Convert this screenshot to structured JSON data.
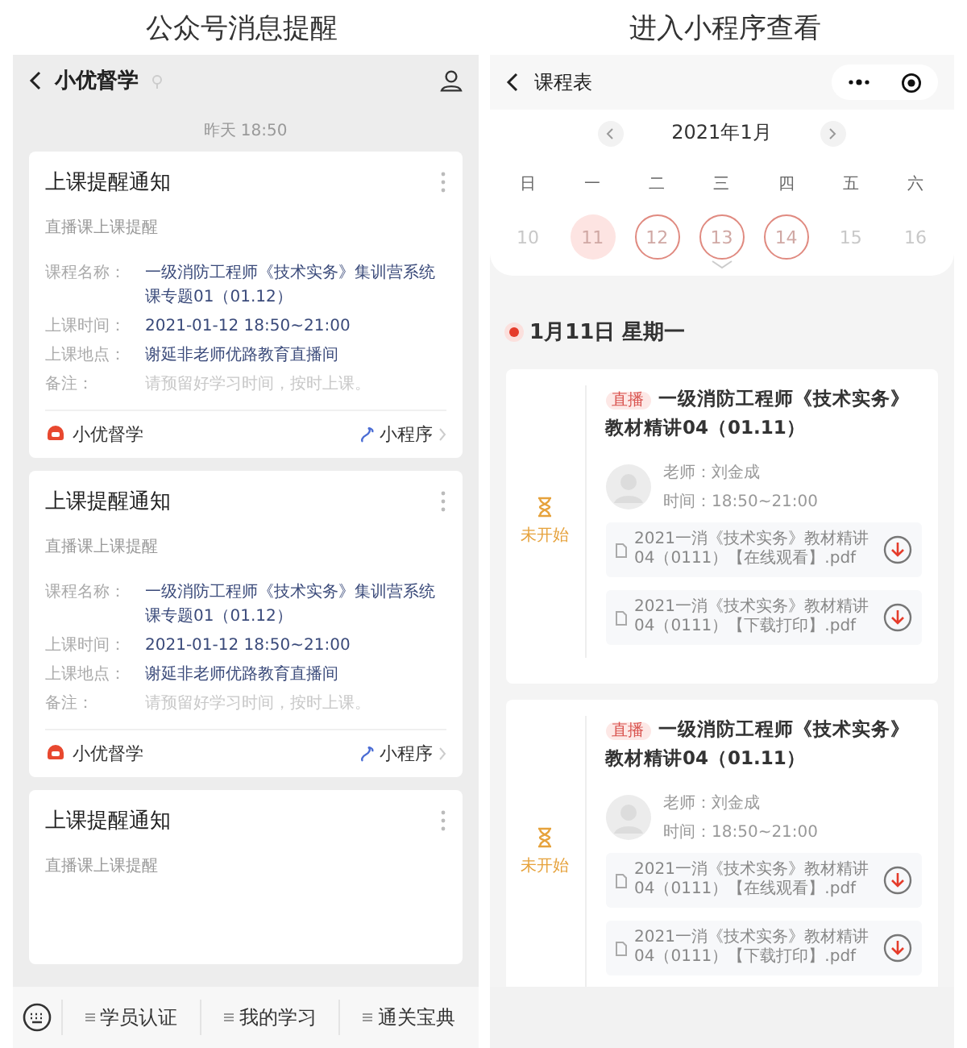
{
  "captions": [
    "公众号消息提醒",
    "进入小程序查看"
  ],
  "left": {
    "header": {
      "title": "小优督学"
    },
    "timestamp": "昨天 18:50",
    "messages": [
      {
        "title": "上课提醒通知",
        "subtitle": "直播课上课提醒",
        "fields": [
          {
            "label": "课程名称：",
            "value": "一级消防工程师《技术实务》集训营系统课专题01（01.12）",
            "kind": "info"
          },
          {
            "label": "上课时间：",
            "value": "2021-01-12 18:50~21:00",
            "kind": "info"
          },
          {
            "label": "上课地点：",
            "value": "谢延非老师优路教育直播间",
            "kind": "info"
          },
          {
            "label": "备注：",
            "value": "请预留好学习时间，按时上课。",
            "kind": "note"
          }
        ],
        "footer": {
          "brand": "小优督学",
          "link": "小程序"
        }
      },
      {
        "title": "上课提醒通知",
        "subtitle": "直播课上课提醒",
        "fields": [
          {
            "label": "课程名称：",
            "value": "一级消防工程师《技术实务》集训营系统课专题01（01.12）",
            "kind": "info"
          },
          {
            "label": "上课时间：",
            "value": "2021-01-12 18:50~21:00",
            "kind": "info"
          },
          {
            "label": "上课地点：",
            "value": "谢延非老师优路教育直播间",
            "kind": "info"
          },
          {
            "label": "备注：",
            "value": "请预留好学习时间，按时上课。",
            "kind": "note"
          }
        ],
        "footer": {
          "brand": "小优督学",
          "link": "小程序"
        }
      },
      {
        "title": "上课提醒通知",
        "subtitle": "直播课上课提醒"
      }
    ],
    "menu": [
      "学员认证",
      "我的学习",
      "通关宝典"
    ]
  },
  "right": {
    "header": {
      "title": "课程表"
    },
    "month": "2021年1月",
    "weekdays": [
      "日",
      "一",
      "二",
      "三",
      "四",
      "五",
      "六"
    ],
    "days": [
      {
        "label": "10",
        "selected": false,
        "has_course": false
      },
      {
        "label": "11",
        "selected": true,
        "has_course": false
      },
      {
        "label": "12",
        "selected": false,
        "has_course": true
      },
      {
        "label": "13",
        "selected": false,
        "has_course": true
      },
      {
        "label": "14",
        "selected": false,
        "has_course": true
      },
      {
        "label": "15",
        "selected": false,
        "has_course": false
      },
      {
        "label": "16",
        "selected": false,
        "has_course": false
      }
    ],
    "date_heading": "1月11日 星期一",
    "courses": [
      {
        "status": "未开始",
        "tag": "直播",
        "title": "一级消防工程师《技术实务》教材精讲04（01.11）",
        "teacher": "老师：刘金成",
        "time": "时间：18:50~21:00",
        "files": [
          {
            "lines": [
              "2021一消《技术实务》教材精讲",
              "04（0111）【在线观看】.pdf"
            ]
          },
          {
            "lines": [
              "2021一消《技术实务》教材精讲",
              "04（0111）【下载打印】.pdf"
            ]
          }
        ]
      },
      {
        "status": "未开始",
        "tag": "直播",
        "title": "一级消防工程师《技术实务》教材精讲04（01.11）",
        "teacher": "老师：刘金成",
        "time": "时间：18:50~21:00",
        "files": [
          {
            "lines": [
              "2021一消《技术实务》教材精讲",
              "04（0111）【在线观看】.pdf"
            ]
          },
          {
            "lines": [
              "2021一消《技术实务》教材精讲",
              "04（0111）【下载打印】.pdf"
            ]
          }
        ]
      }
    ]
  }
}
